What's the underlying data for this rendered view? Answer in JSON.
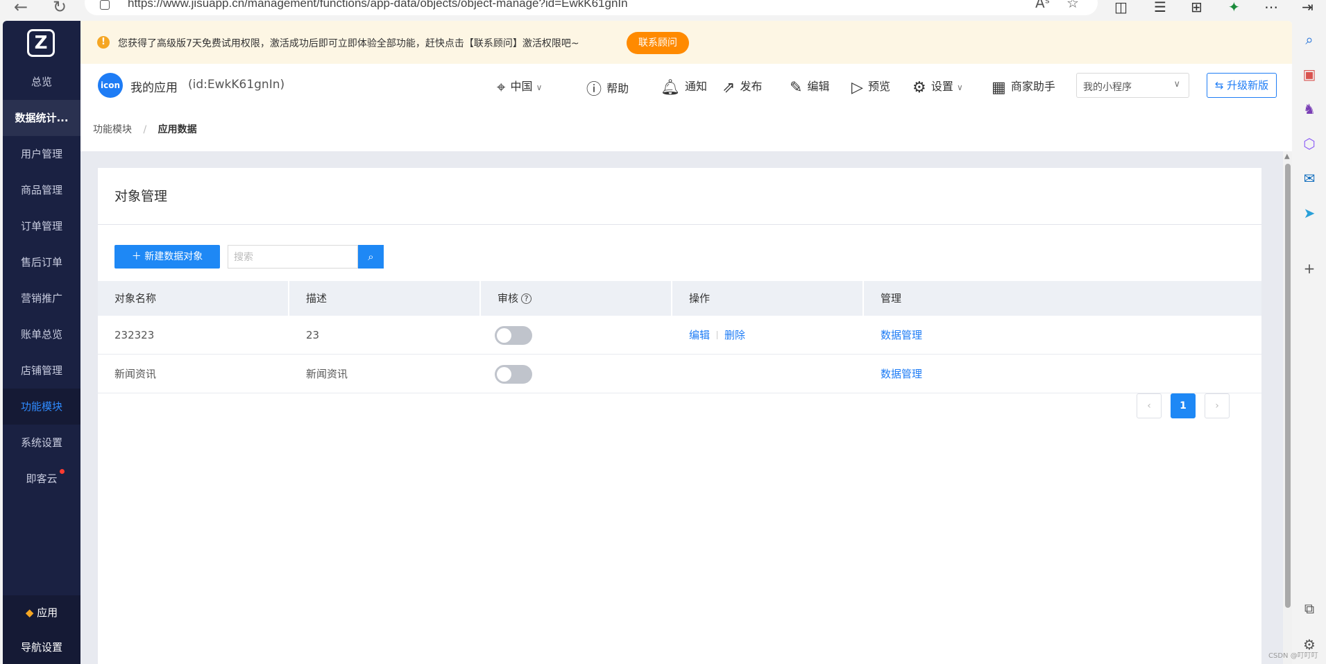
{
  "browser": {
    "url": "https://www.jisuapp.cn/management/functions/app-data/objects/object-manage?id=EwkK61gnIn",
    "read_aloud": "Aˢ",
    "favorite": "☆"
  },
  "sidebar": {
    "logo": "Z",
    "items": [
      {
        "label": "总览"
      },
      {
        "label": "数据统计..."
      },
      {
        "label": "用户管理"
      },
      {
        "label": "商品管理"
      },
      {
        "label": "订单管理"
      },
      {
        "label": "售后订单"
      },
      {
        "label": "营销推广"
      },
      {
        "label": "账单总览"
      },
      {
        "label": "店铺管理"
      },
      {
        "label": "功能模块"
      },
      {
        "label": "系统设置"
      },
      {
        "label": "即客云"
      }
    ],
    "bottom": [
      {
        "label": "应用"
      },
      {
        "label": "导航设置"
      }
    ]
  },
  "notice": {
    "text": "您获得了高级版7天免费试用权限，激活成功后即可立即体验全部功能，赶快点击【联系顾问】激活权限吧~",
    "button": "联系顾问"
  },
  "topnav": {
    "avatar_text": "icon",
    "app_name": "我的应用",
    "app_id": "(id:EwkK61gnIn)",
    "region": "中国",
    "help": "帮助",
    "notify": "通知",
    "publish": "发布",
    "edit": "编辑",
    "preview": "预览",
    "settings": "设置",
    "merchant": "商家助手",
    "mini_program_select": "我的小程序",
    "upgrade": "升级新版"
  },
  "breadcrumb": {
    "parent": "功能模块",
    "separator": "/",
    "current": "应用数据"
  },
  "card": {
    "title": "对象管理",
    "new_button": "新建数据对象",
    "search_placeholder": "搜索",
    "columns": [
      "对象名称",
      "描述",
      "审核",
      "操作",
      "管理"
    ],
    "rows": [
      {
        "name": "232323",
        "desc": "23",
        "review_on": false,
        "edit": "编辑",
        "delete": "删除",
        "manage": "数据管理"
      },
      {
        "name": "新闻资讯",
        "desc": "新闻资讯",
        "review_on": false,
        "edit": "",
        "delete": "",
        "manage": "数据管理"
      }
    ],
    "pagination": {
      "current": "1",
      "prev": "‹",
      "next": "›"
    }
  },
  "watermark": "CSDN @叮叮叮",
  "colors": {
    "sidebar_bg": "#1a2142",
    "primary": "#1e88f5",
    "notice_bg": "#fdf6e4",
    "notice_button": "#ff8a00"
  }
}
